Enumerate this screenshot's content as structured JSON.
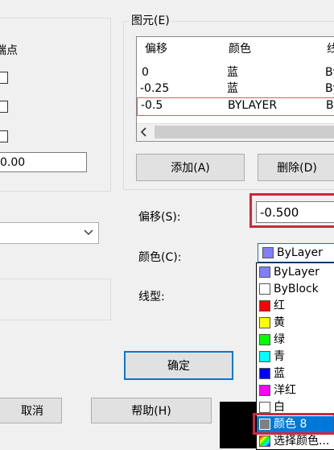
{
  "left_panel": {
    "endpoint_label": "端点",
    "value_field": "0.00",
    "cancel_button": "取消",
    "help_button": "帮助(H)"
  },
  "elements_group": {
    "title": "图元(E)",
    "columns": [
      "偏移",
      "颜色",
      "线"
    ],
    "rows": [
      {
        "offset": "0",
        "color": "蓝",
        "linetype": "By"
      },
      {
        "offset": "-0.25",
        "color": "蓝",
        "linetype": "By"
      },
      {
        "offset": "-0.5",
        "color": "BYLAYER",
        "linetype": "By"
      }
    ],
    "add_button": "添加(A)",
    "delete_button": "删除(D)"
  },
  "offset_field": {
    "label": "偏移(S):",
    "value": "-0.500"
  },
  "color_field": {
    "label": "颜色(C):",
    "value": "ByLayer",
    "value_color": "#8080ff"
  },
  "linetype_field": {
    "label": "线型:"
  },
  "ok_button": "确定",
  "color_dropdown": {
    "items": [
      {
        "label": "ByLayer",
        "color": "#8080ff"
      },
      {
        "label": "ByBlock",
        "color": "#ffffff"
      },
      {
        "label": "红",
        "color": "#ff0000"
      },
      {
        "label": "黄",
        "color": "#ffff00"
      },
      {
        "label": "绿",
        "color": "#00ff00"
      },
      {
        "label": "青",
        "color": "#00ffff"
      },
      {
        "label": "蓝",
        "color": "#0000ff"
      },
      {
        "label": "洋红",
        "color": "#ff00ff"
      },
      {
        "label": "白",
        "color": "#ffffff"
      },
      {
        "label": "颜色 8",
        "color": "#808080"
      },
      {
        "label": "选择颜色...",
        "color": "#ff8800"
      }
    ]
  },
  "colors": {
    "accent_highlight": "#d0263b",
    "selection": "#0078d7"
  }
}
